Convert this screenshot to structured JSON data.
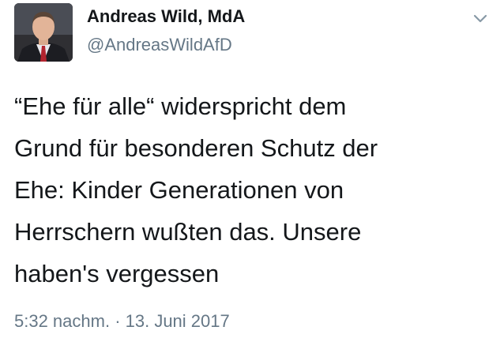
{
  "tweet": {
    "author": {
      "display_name": "Andreas Wild, MdA",
      "handle": "@AndreasWildAfD",
      "avatar_icon": "profile-photo"
    },
    "menu_icon": "chevron-down-icon",
    "text_lines": [
      "“Ehe für alle“ widerspricht dem",
      "Grund für besonderen Schutz der",
      "Ehe: Kinder Generationen von",
      "Herrschern wußten das. Unsere",
      "haben's vergessen"
    ],
    "timestamp": "5:32 nachm. · 13. Juni 2017"
  },
  "colors": {
    "text_primary": "#14171a",
    "text_secondary": "#657786",
    "chevron": "#8899a6"
  }
}
